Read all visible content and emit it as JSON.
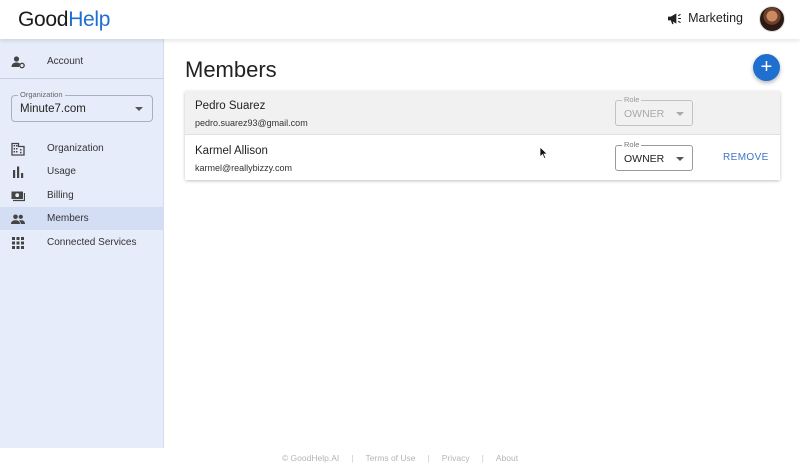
{
  "app": {
    "logo_part1": "Good",
    "logo_part2": "Help"
  },
  "header": {
    "workspace_label": "Marketing",
    "workspace_icon": "megaphone-icon",
    "avatar": "user-avatar"
  },
  "sidebar": {
    "account_label": "Account",
    "organization_select": {
      "legend": "Organization",
      "value": "Minute7.com"
    },
    "items": [
      {
        "label": "Organization",
        "icon": "building-icon"
      },
      {
        "label": "Usage",
        "icon": "bar-chart-icon"
      },
      {
        "label": "Billing",
        "icon": "money-icon"
      },
      {
        "label": "Members",
        "icon": "people-icon",
        "active": true
      },
      {
        "label": "Connected Services",
        "icon": "grid-icon"
      }
    ]
  },
  "main": {
    "title": "Members",
    "add_button": "+",
    "members": [
      {
        "name": "Pedro Suarez",
        "email": "pedro.suarez93@gmail.com",
        "role_legend": "Role",
        "role": "OWNER",
        "disabled": true
      },
      {
        "name": "Karmel Allison",
        "email": "karmel@reallybizzy.com",
        "role_legend": "Role",
        "role": "OWNER",
        "remove_label": "REMOVE"
      }
    ]
  },
  "footer": {
    "copyright": "© GoodHelp.AI",
    "terms": "Terms of Use",
    "privacy": "Privacy",
    "about": "About",
    "separator": "|"
  }
}
